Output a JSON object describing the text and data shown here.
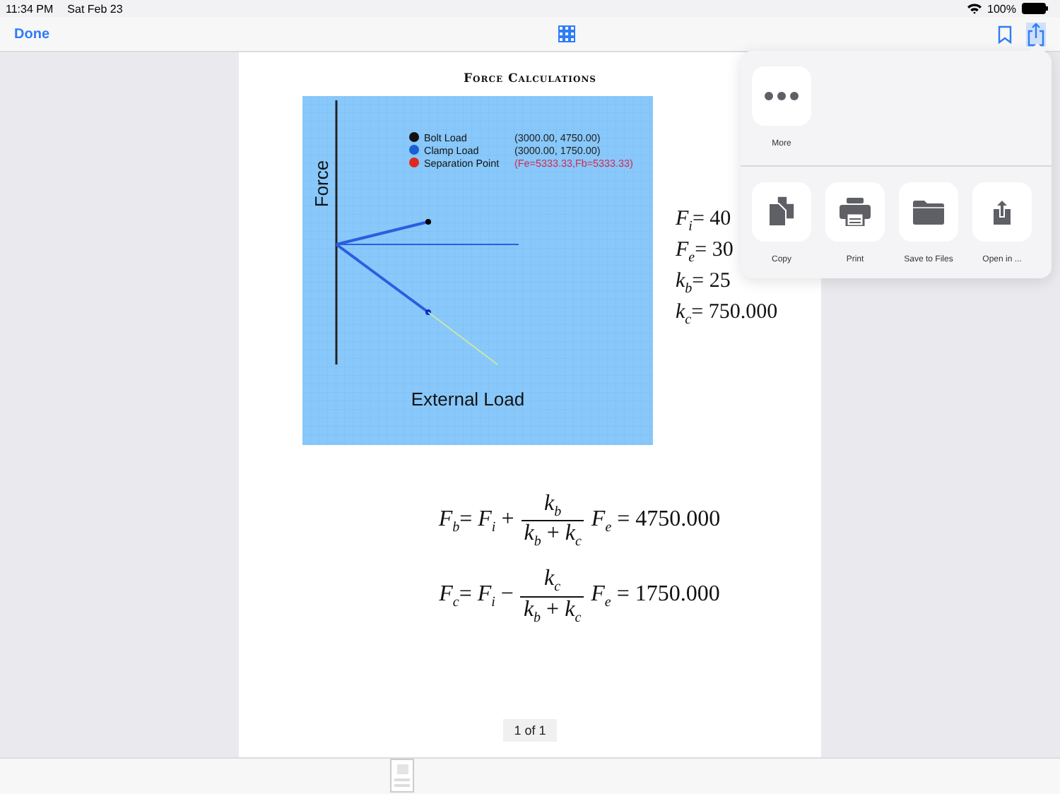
{
  "status_bar": {
    "time": "11:34 PM",
    "date": "Sat Feb 23",
    "battery": "100%"
  },
  "toolbar": {
    "done": "Done"
  },
  "document": {
    "title": "Force Calculations",
    "plot": {
      "y_label": "Force",
      "x_label": "External Load",
      "legend": [
        {
          "name": "Bolt Load",
          "value": "(3000.00,  4750.00)",
          "color": "#111111",
          "highlighted": false
        },
        {
          "name": "Clamp Load",
          "value": "(3000.00,  1750.00)",
          "color": "#1a5fd6",
          "highlighted": false
        },
        {
          "name": "Separation Point",
          "value": "(Fe=5333.33,Fb=5333.33)",
          "color": "#e0281e",
          "highlighted": true
        }
      ]
    },
    "variables": [
      "*F*$_{i}$= 40",
      "*F*$_{e}$= 30",
      "*k*$_{b}$= 25",
      "*k*$_{c}$= 750.000"
    ],
    "equations": [
      {
        "lhs": "*F*$_{b}$= *F*$_{i}$ +",
        "numerator": "*k*$_{b}$",
        "denominator": "*k*$_{b}$ + *k*$_{c}$",
        "rhs": "*F*$_{e}$ = 4750.000"
      },
      {
        "lhs": "*F*$_{c}$= *F*$_{i}$ −",
        "numerator": "*k*$_{c}$",
        "denominator": "*k*$_{b}$ + *k*$_{c}$",
        "rhs": "*F*$_{e}$ = 1750.000"
      }
    ],
    "page_indicator": "1 of 1"
  },
  "share_sheet": {
    "more": "More",
    "actions": [
      {
        "kind": "copy",
        "label": "Copy"
      },
      {
        "kind": "print",
        "label": "Print"
      },
      {
        "kind": "folder",
        "label": "Save to Files"
      },
      {
        "kind": "open",
        "label": "Open in ..."
      }
    ]
  }
}
